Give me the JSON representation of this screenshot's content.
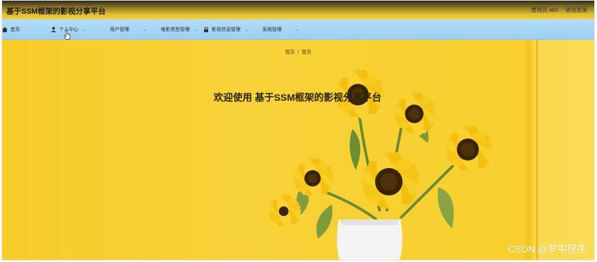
{
  "header": {
    "title": "基于SSM框架的影视分享平台",
    "user_label": "管理员 abo",
    "logout_label": "退出登录"
  },
  "nav": {
    "items": [
      {
        "label": "首页",
        "icon": "home-icon"
      },
      {
        "label": "个人中心",
        "icon": "person-icon"
      },
      {
        "label": "用户管理",
        "icon": "grid-icon"
      },
      {
        "label": "电影类型管理",
        "icon": "grid-icon"
      },
      {
        "label": "影视信息管理",
        "icon": "lock-icon"
      },
      {
        "label": "系统管理",
        "icon": "grid-icon"
      }
    ]
  },
  "main": {
    "breadcrumb": [
      "首页",
      "首页"
    ],
    "welcome": "欢迎使用 基于SSM框架的影视分享平台"
  },
  "watermark": "CSDN @罗中程序",
  "colors": {
    "topbar": "#e2c032",
    "nav_bg": "#9cd0f6",
    "wall": "#f8d23a",
    "petal": "#f5c518",
    "center": "#3b2406",
    "vase": "#f4f4f2"
  }
}
